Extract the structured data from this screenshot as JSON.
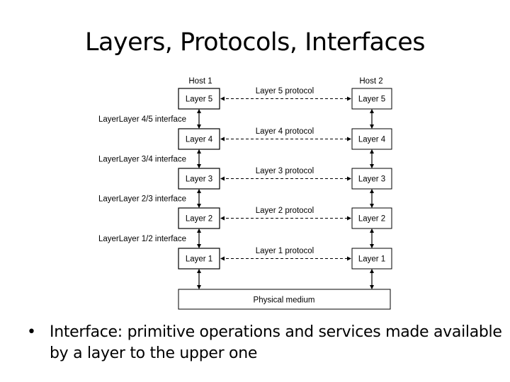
{
  "slide": {
    "title": "Layers, Protocols, Interfaces",
    "bullet_symbol": "•",
    "bullet_text": "Interface: primitive operations and services made available by a layer to the upper one"
  },
  "diagram": {
    "host_left": "Host 1",
    "host_right": "Host 2",
    "layers": [
      {
        "label": "Layer 5",
        "protocol": "Layer 5 protocol"
      },
      {
        "label": "Layer 4",
        "protocol": "Layer 4 protocol"
      },
      {
        "label": "Layer 3",
        "protocol": "Layer 3 protocol"
      },
      {
        "label": "Layer 2",
        "protocol": "Layer 2 protocol"
      },
      {
        "label": "Layer 1",
        "protocol": "Layer 1 protocol"
      }
    ],
    "interfaces": [
      "LayerLayer 4/5 interface",
      "LayerLayer 3/4 interface",
      "LayerLayer 2/3 interface",
      "LayerLayer 1/2 interface"
    ],
    "physical_medium": "Physical medium"
  }
}
